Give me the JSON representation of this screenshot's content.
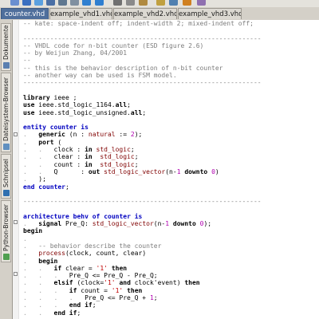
{
  "toolbar": {
    "icons": [
      {
        "name": "new-file-icon",
        "color": "#6a8fd0"
      },
      {
        "name": "open-file-icon",
        "color": "#3a6fc0"
      },
      {
        "name": "reload-icon",
        "color": "#5aa0e0"
      },
      {
        "name": "save-icon",
        "color": "#4a6fa5"
      },
      {
        "name": "save-as-icon",
        "color": "#607890"
      },
      {
        "name": "close-icon",
        "color": "#8090a0"
      },
      {
        "name": "undo-icon",
        "color": "#2f7fd0"
      },
      {
        "name": "redo-icon",
        "color": "#2f7fd0"
      },
      {
        "name": "cut-icon",
        "color": "#707070"
      },
      {
        "name": "copy-icon",
        "color": "#8a8a8a"
      },
      {
        "name": "paste-icon",
        "color": "#b08a40"
      },
      {
        "name": "find-icon",
        "color": "#c0a040"
      },
      {
        "name": "replace-icon",
        "color": "#5080b0"
      },
      {
        "name": "zoom-icon",
        "color": "#d08020"
      },
      {
        "name": "tools-icon",
        "color": "#8f70b0"
      }
    ]
  },
  "tabs": [
    {
      "label": "counter.vhd",
      "active": true
    },
    {
      "label": "example_vhd1.vhd",
      "active": false
    },
    {
      "label": "example_vhd2.vhd",
      "active": false
    },
    {
      "label": "example_vhd3.vhd",
      "active": false
    }
  ],
  "sidebar": {
    "items": [
      {
        "label": "Dokumente",
        "icon": "documents-icon",
        "color": "#5a7fb0"
      },
      {
        "label": "Dateisystem-Browser",
        "icon": "filesystem-icon",
        "color": "#6090c0"
      },
      {
        "label": "Schnipsel",
        "icon": "snippets-icon",
        "color": "#3070b0"
      },
      {
        "label": "Python-Browser",
        "icon": "python-browser-icon",
        "color": "#50a050"
      }
    ]
  },
  "code": {
    "lines": [
      [
        [
          "c",
          "-- kate: space-indent off; indent-width 2; mixed-indent off;"
        ]
      ],
      [],
      [
        [
          "c",
          "--------------------------------------------------------------"
        ]
      ],
      [
        [
          "c",
          "-- VHDL code for n-bit counter (ESD figure 2.6)"
        ]
      ],
      [
        [
          "c",
          "-- by Weijun Zhang, 04/2001"
        ]
      ],
      [
        [
          "c",
          "--"
        ]
      ],
      [
        [
          "c",
          "-- this is the behavior description of n-bit counter"
        ]
      ],
      [
        [
          "c",
          "-- another way can be used is FSM model."
        ]
      ],
      [
        [
          "c",
          "--------------------------------------------------------------"
        ]
      ],
      [],
      [
        [
          "k",
          "library"
        ],
        [
          "p",
          " ieee ;"
        ]
      ],
      [
        [
          "k",
          "use"
        ],
        [
          "p",
          " ieee.std_logic_1164."
        ],
        [
          "k",
          "all"
        ],
        [
          "p",
          ";"
        ]
      ],
      [
        [
          "k",
          "use"
        ],
        [
          "p",
          " ieee.std_logic_unsigned."
        ],
        [
          "k",
          "all"
        ],
        [
          "p",
          ";"
        ]
      ],
      [],
      [
        [
          "kb",
          "entity"
        ],
        [
          "p",
          " "
        ],
        [
          "kb",
          "counter"
        ],
        [
          "p",
          " "
        ],
        [
          "kb",
          "is"
        ]
      ],
      [
        [
          "d",
          ".   "
        ],
        [
          "k",
          "generic"
        ],
        [
          "p",
          " (n : "
        ],
        [
          "t",
          "natural"
        ],
        [
          "p",
          " := "
        ],
        [
          "n",
          "2"
        ],
        [
          "p",
          ");"
        ]
      ],
      [
        [
          "d",
          ".   "
        ],
        [
          "k",
          "port"
        ],
        [
          "p",
          " ("
        ]
      ],
      [
        [
          "d",
          ".   .   "
        ],
        [
          "p",
          "clock : "
        ],
        [
          "k",
          "in"
        ],
        [
          "p",
          " "
        ],
        [
          "t",
          "std_logic"
        ],
        [
          "p",
          ";"
        ]
      ],
      [
        [
          "d",
          ".   .   "
        ],
        [
          "p",
          "clear : "
        ],
        [
          "k",
          "in"
        ],
        [
          "p",
          "  "
        ],
        [
          "t",
          "std_logic"
        ],
        [
          "p",
          ";"
        ]
      ],
      [
        [
          "d",
          ".   .   "
        ],
        [
          "p",
          "count : "
        ],
        [
          "k",
          "in"
        ],
        [
          "p",
          "  "
        ],
        [
          "t",
          "std_logic"
        ],
        [
          "p",
          ";"
        ]
      ],
      [
        [
          "d",
          ".   .   "
        ],
        [
          "p",
          "Q      : "
        ],
        [
          "k",
          "out"
        ],
        [
          "p",
          " "
        ],
        [
          "t",
          "std_logic_vector"
        ],
        [
          "p",
          "(n-"
        ],
        [
          "n",
          "1"
        ],
        [
          "p",
          " "
        ],
        [
          "k",
          "downto"
        ],
        [
          "p",
          " "
        ],
        [
          "n",
          "0"
        ],
        [
          "p",
          ")"
        ]
      ],
      [
        [
          "d",
          ".   "
        ],
        [
          "p",
          ");"
        ]
      ],
      [
        [
          "kb",
          "end"
        ],
        [
          "p",
          " "
        ],
        [
          "kb",
          "counter"
        ],
        [
          "p",
          ";"
        ]
      ],
      [],
      [
        [
          "c",
          "--------------------------------------------------------------"
        ]
      ],
      [],
      [
        [
          "kb",
          "architecture"
        ],
        [
          "p",
          " "
        ],
        [
          "kb",
          "behv"
        ],
        [
          "p",
          " "
        ],
        [
          "kb",
          "of"
        ],
        [
          "p",
          " "
        ],
        [
          "kb",
          "counter"
        ],
        [
          "p",
          " "
        ],
        [
          "kb",
          "is"
        ]
      ],
      [
        [
          "d",
          ".   "
        ],
        [
          "k",
          "signal"
        ],
        [
          "p",
          " Pre_Q: "
        ],
        [
          "t",
          "std_logic_vector"
        ],
        [
          "p",
          "(n-"
        ],
        [
          "n",
          "1"
        ],
        [
          "p",
          " "
        ],
        [
          "k",
          "downto"
        ],
        [
          "p",
          " "
        ],
        [
          "n",
          "0"
        ],
        [
          "p",
          ");"
        ]
      ],
      [
        [
          "k",
          "begin"
        ]
      ],
      [
        [
          "d",
          "."
        ]
      ],
      [
        [
          "d",
          ".   "
        ],
        [
          "c",
          "-- behavior describe the counter"
        ]
      ],
      [
        [
          "d",
          ".   "
        ],
        [
          "t",
          "process"
        ],
        [
          "p",
          "(clock, count, clear)"
        ]
      ],
      [
        [
          "d",
          ".   "
        ],
        [
          "k",
          "begin"
        ]
      ],
      [
        [
          "d",
          ".   .   "
        ],
        [
          "k",
          "if"
        ],
        [
          "p",
          " clear = "
        ],
        [
          "s",
          "'1'"
        ],
        [
          "p",
          " "
        ],
        [
          "k",
          "then"
        ]
      ],
      [
        [
          "d",
          ".   .   .   "
        ],
        [
          "p",
          "Pre_Q <= Pre_Q - Pre_Q;"
        ]
      ],
      [
        [
          "d",
          ".   .   "
        ],
        [
          "k",
          "elsif"
        ],
        [
          "p",
          " (clock="
        ],
        [
          "s",
          "'1'"
        ],
        [
          "p",
          " "
        ],
        [
          "k",
          "and"
        ],
        [
          "p",
          " clock'event) "
        ],
        [
          "k",
          "then"
        ]
      ],
      [
        [
          "d",
          ".   .   .   "
        ],
        [
          "k",
          "if"
        ],
        [
          "p",
          " count = "
        ],
        [
          "s",
          "'1'"
        ],
        [
          "p",
          " "
        ],
        [
          "k",
          "then"
        ]
      ],
      [
        [
          "d",
          ".   .   .   .   "
        ],
        [
          "p",
          "Pre_Q <= Pre_Q + "
        ],
        [
          "n",
          "1"
        ],
        [
          "p",
          ";"
        ]
      ],
      [
        [
          "d",
          ".   .   .   "
        ],
        [
          "k",
          "end if"
        ],
        [
          "p",
          ";"
        ]
      ],
      [
        [
          "d",
          ".   .   "
        ],
        [
          "k",
          "end if"
        ],
        [
          "p",
          ";"
        ]
      ]
    ]
  }
}
